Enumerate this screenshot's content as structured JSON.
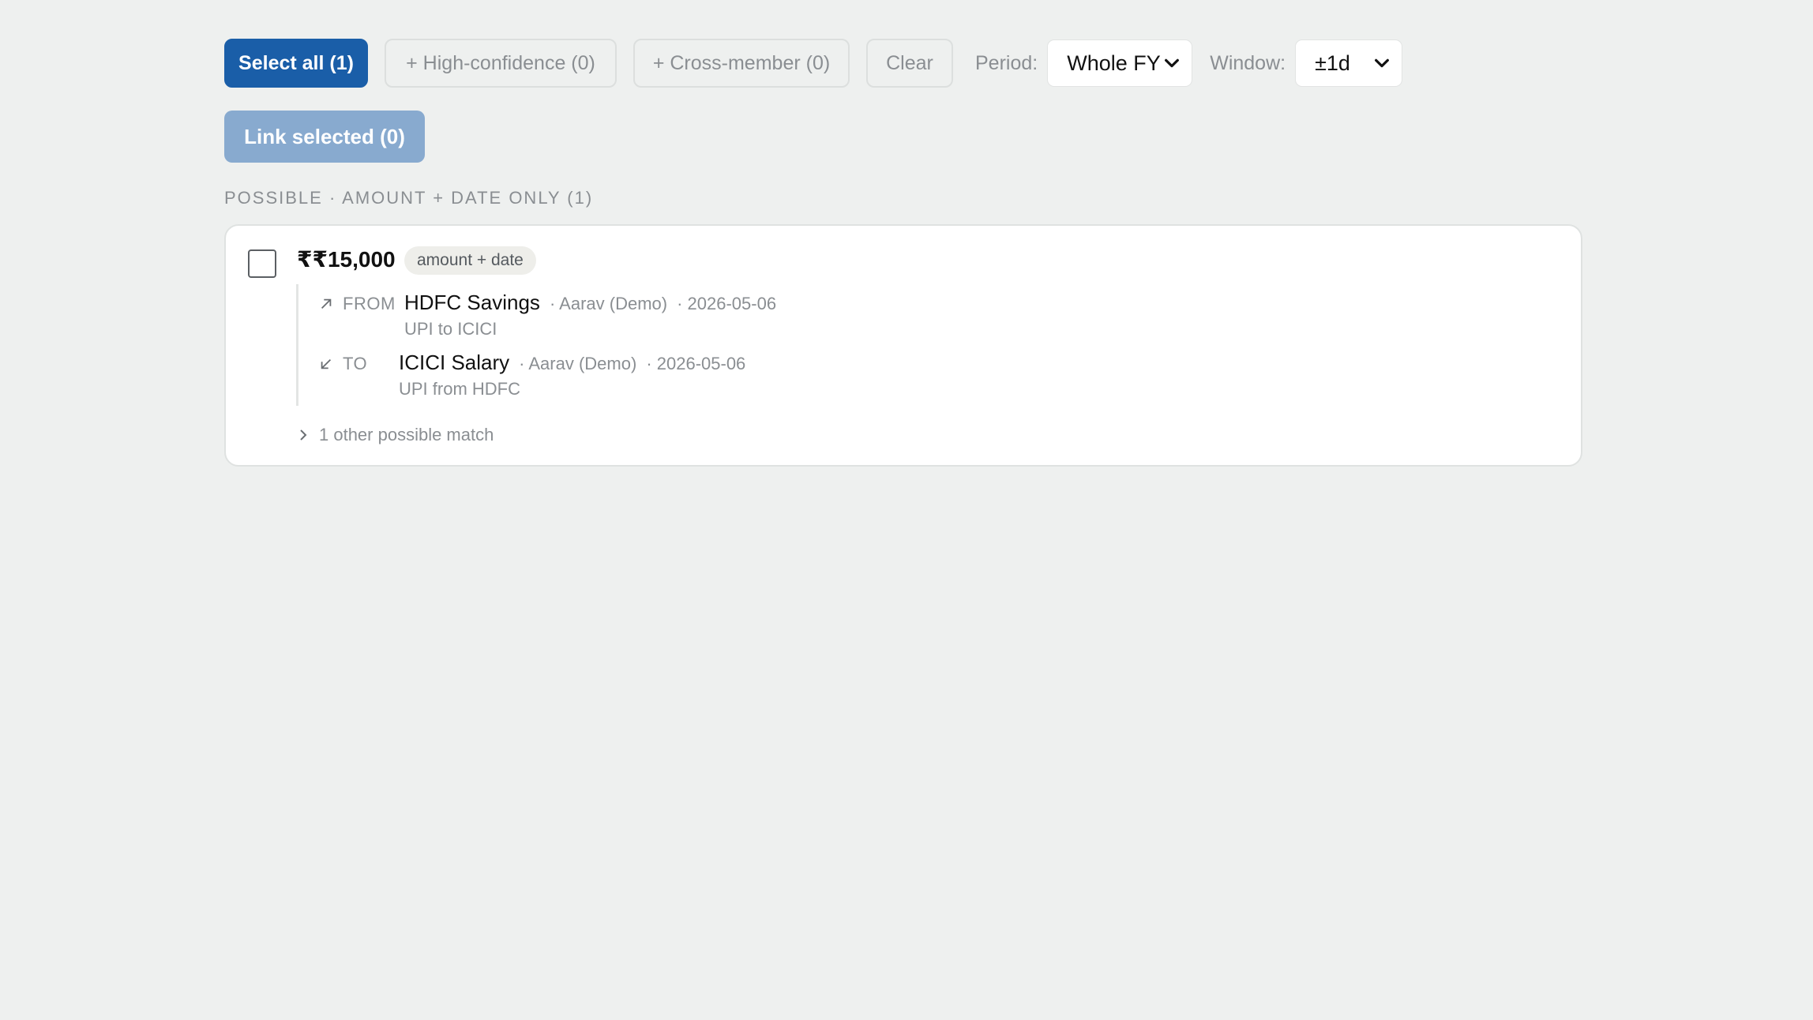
{
  "toolbar": {
    "select_all_label": "Select all (1)",
    "high_confidence_label": "+ High-confidence (0)",
    "cross_member_label": "+ Cross-member (0)",
    "clear_label": "Clear",
    "period_label": "Period:",
    "period_value": "Whole FY",
    "window_label": "Window:",
    "window_value": "±1d",
    "link_selected_label": "Link selected (0)"
  },
  "section": {
    "heading": "POSSIBLE · AMOUNT + DATE ONLY (1)"
  },
  "match": {
    "amount": "₹₹15,000",
    "badge": "amount + date",
    "checked": false,
    "from": {
      "direction_label": "FROM",
      "direction_icon": "arrow-up-right-icon",
      "account": "HDFC Savings",
      "member": "· Aarav (Demo)",
      "date": "· 2026-05-06",
      "description": "UPI to ICICI"
    },
    "to": {
      "direction_label": "TO",
      "direction_icon": "arrow-down-left-icon",
      "account": "ICICI Salary",
      "member": "· Aarav (Demo)",
      "date": "· 2026-05-06",
      "description": "UPI from HDFC"
    },
    "other_matches_label": "1 other possible match"
  },
  "colors": {
    "primary": "#1a5ea8",
    "primary_disabled": "#88aacf",
    "background": "#eef0ef"
  }
}
